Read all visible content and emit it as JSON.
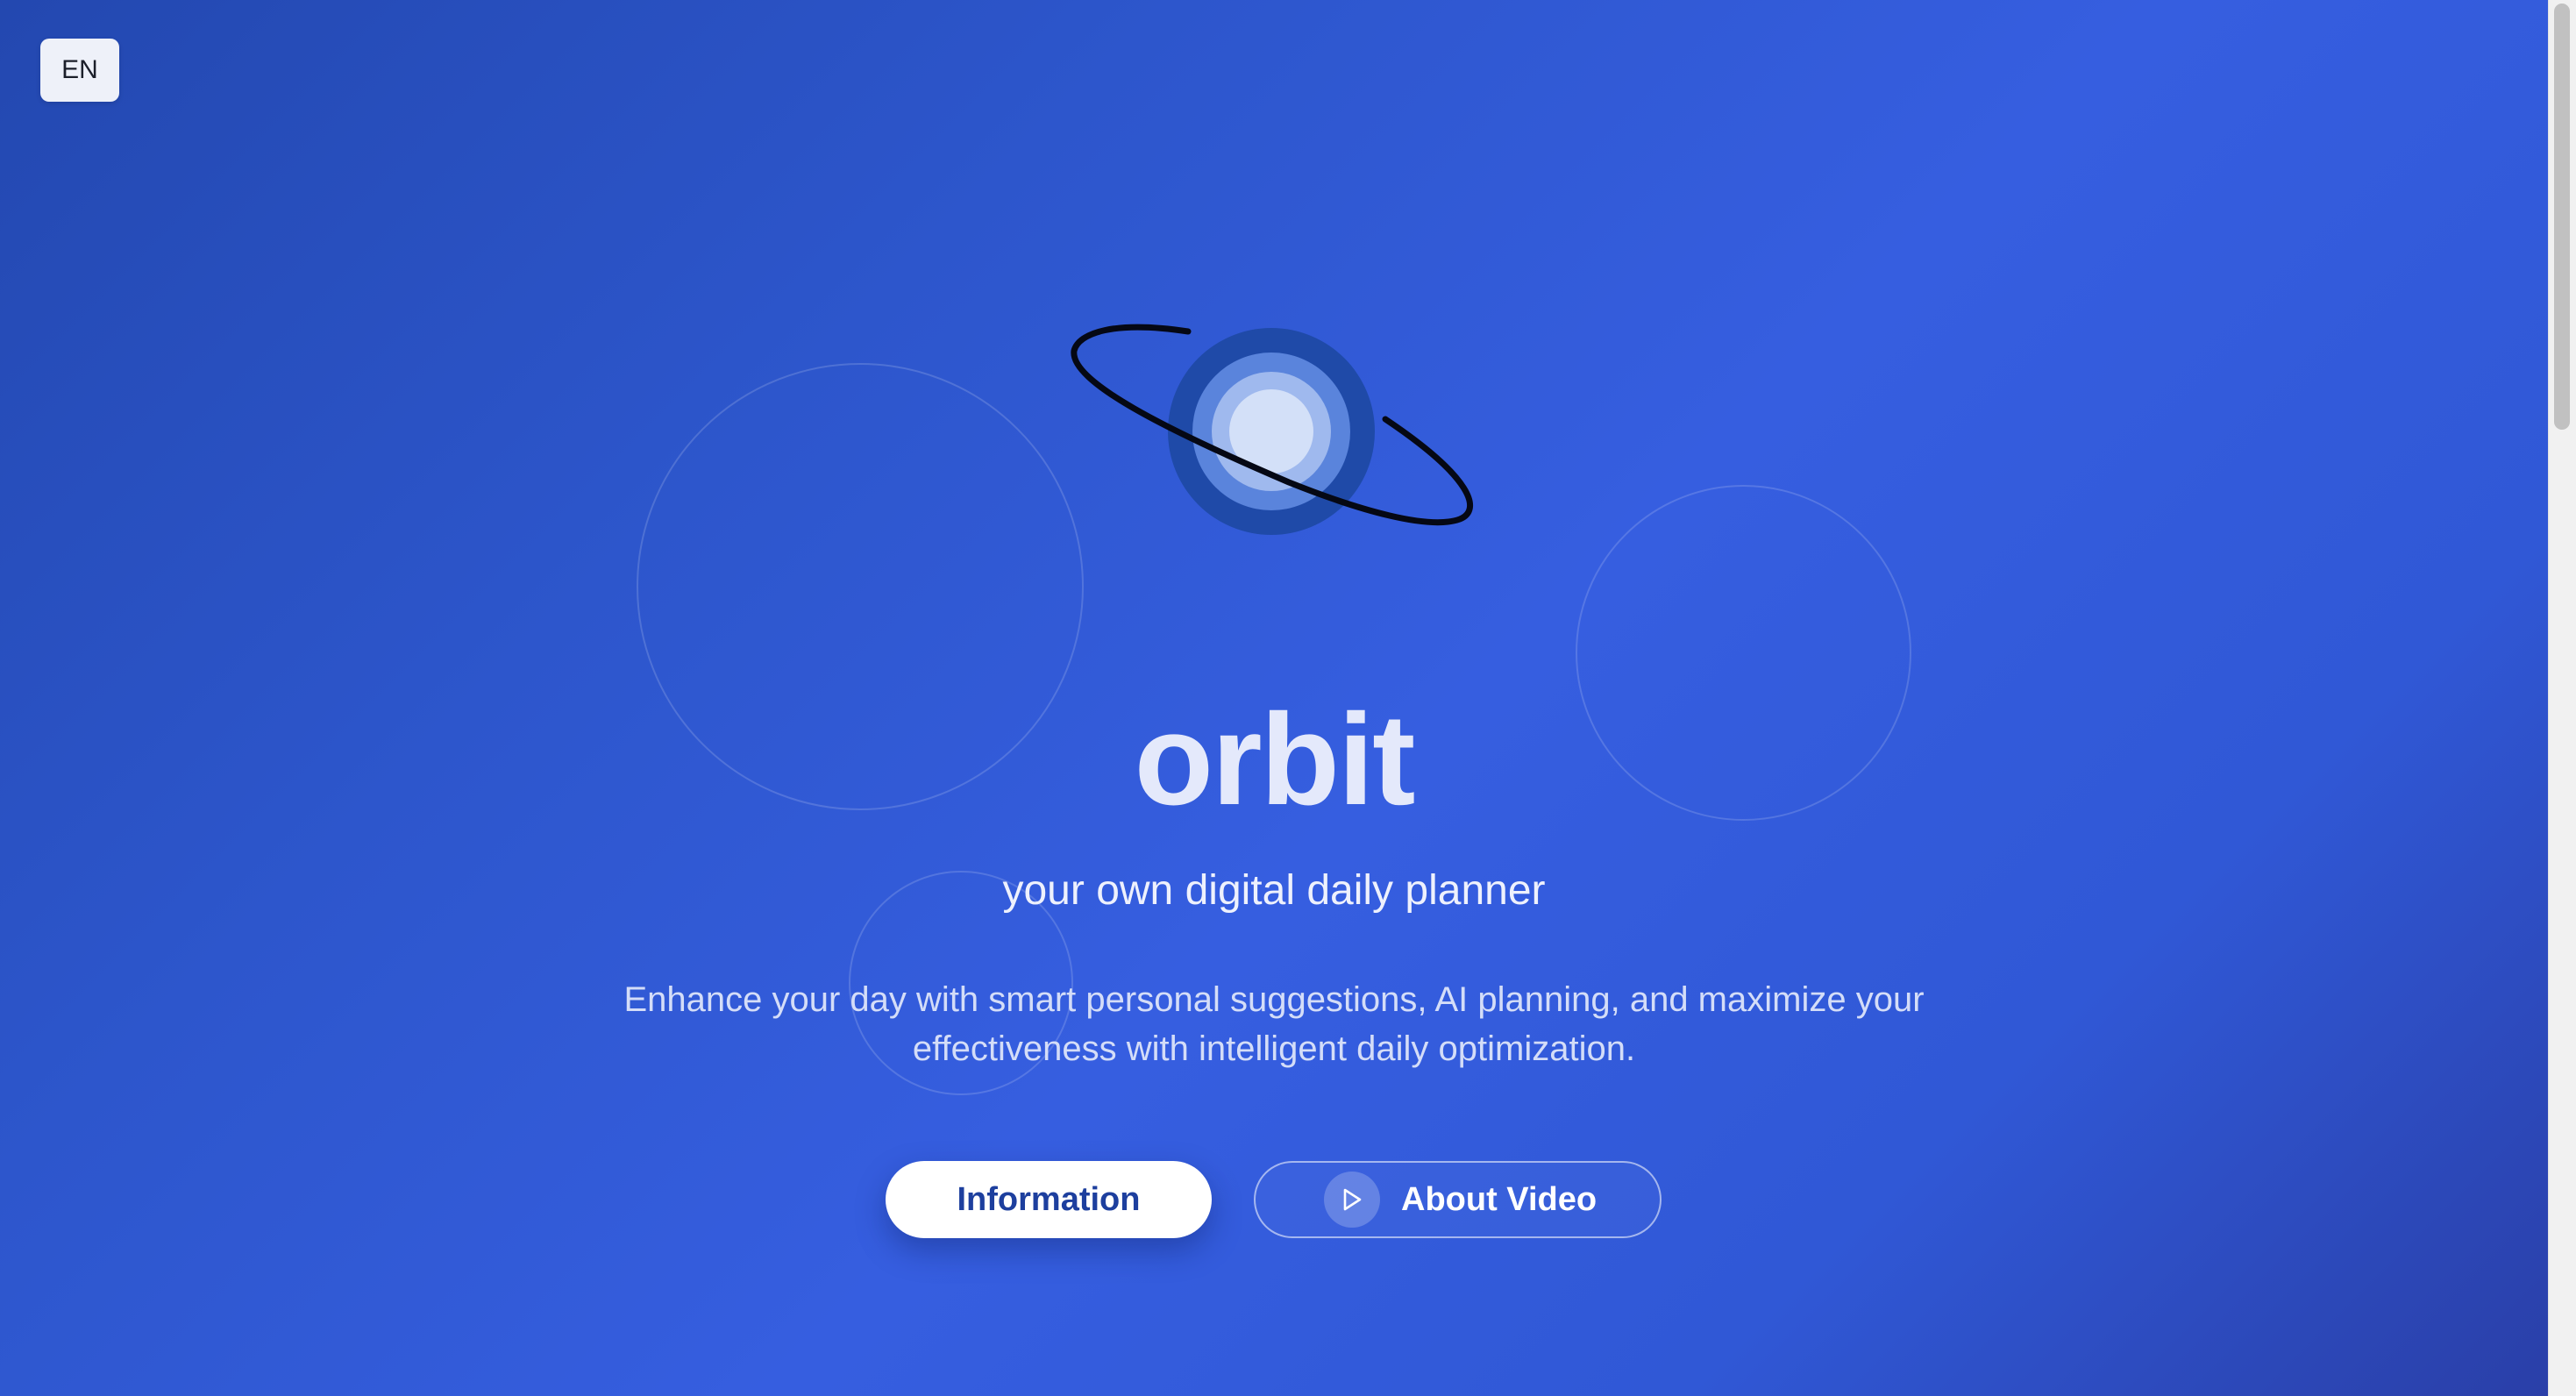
{
  "language": {
    "current": "EN"
  },
  "hero": {
    "title": "orbit",
    "subtitle": "your own digital daily planner",
    "description": "Enhance your day with smart personal suggestions, AI planning, and maximize your effectiveness with intelligent daily optimization."
  },
  "actions": {
    "information_label": "Information",
    "video_label": "About Video"
  },
  "icons": {
    "logo": "orbit-planet-logo",
    "play": "play-icon"
  },
  "colors": {
    "background_start": "#2348b0",
    "background_mid": "#365ee0",
    "background_end": "#2a3fa8",
    "accent_text": "#1d3f9e",
    "logo_outer": "#1f4aa8",
    "logo_middle": "#5a84dc",
    "logo_inner": "#9fb9ee",
    "logo_core": "#d3e0f8"
  }
}
